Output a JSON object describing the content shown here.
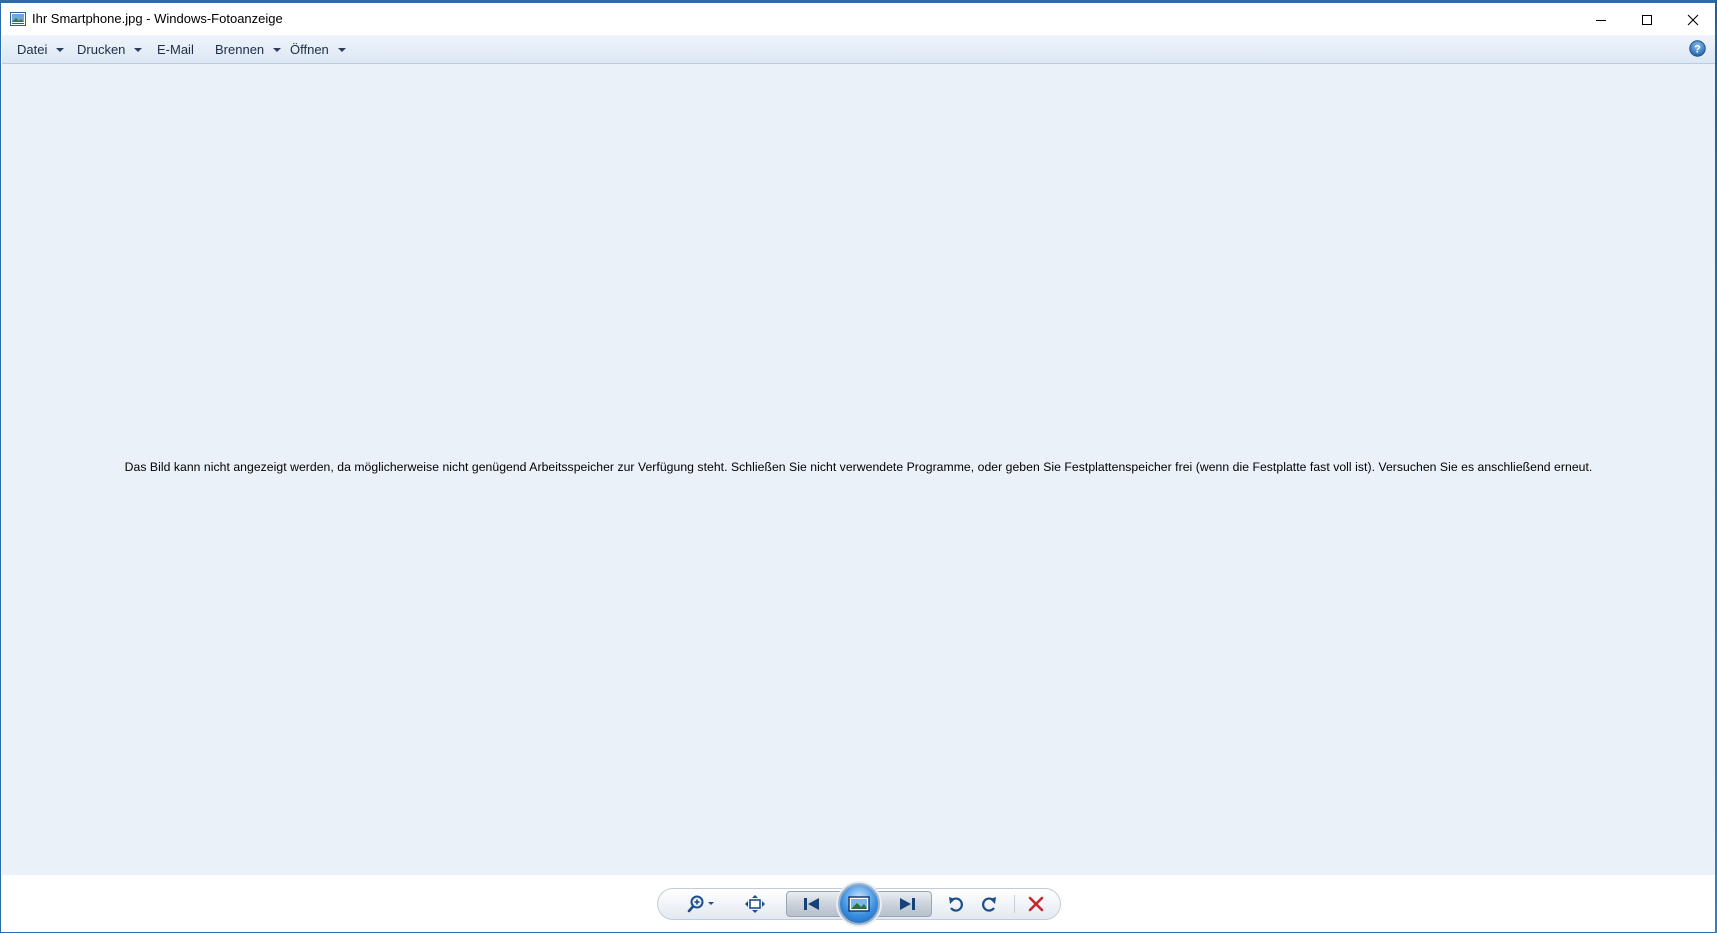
{
  "window": {
    "title": "Ihr Smartphone.jpg - Windows-Fotoanzeige"
  },
  "menu": {
    "items": [
      {
        "label": "Datei",
        "has_dropdown": true
      },
      {
        "label": "Drucken",
        "has_dropdown": true
      },
      {
        "label": "E-Mail",
        "has_dropdown": false
      },
      {
        "label": "Brennen",
        "has_dropdown": true
      },
      {
        "label": "Öffnen",
        "has_dropdown": true
      }
    ],
    "help_icon": "help-icon"
  },
  "content": {
    "error_message": "Das Bild kann nicht angezeigt werden, da möglicherweise nicht genügend Arbeitsspeicher zur Verfügung steht. Schließen Sie nicht verwendete Programme, oder geben Sie Festplattenspeicher frei (wenn die Festplatte fast voll ist). Versuchen Sie es anschließend erneut."
  },
  "toolbar": {
    "buttons": [
      {
        "name": "zoom",
        "icon": "zoom-icon"
      },
      {
        "name": "actual-size",
        "icon": "fit-window-icon"
      },
      {
        "name": "previous",
        "icon": "previous-icon"
      },
      {
        "name": "slideshow",
        "icon": "slideshow-icon"
      },
      {
        "name": "next",
        "icon": "next-icon"
      },
      {
        "name": "rotate-counterclockwise",
        "icon": "rotate-left-icon"
      },
      {
        "name": "rotate-clockwise",
        "icon": "rotate-right-icon"
      },
      {
        "name": "delete",
        "icon": "delete-icon"
      }
    ]
  },
  "colors": {
    "content_bg": "#ebf1f9",
    "accent": "#1c5fb0",
    "delete": "#c4262e"
  }
}
